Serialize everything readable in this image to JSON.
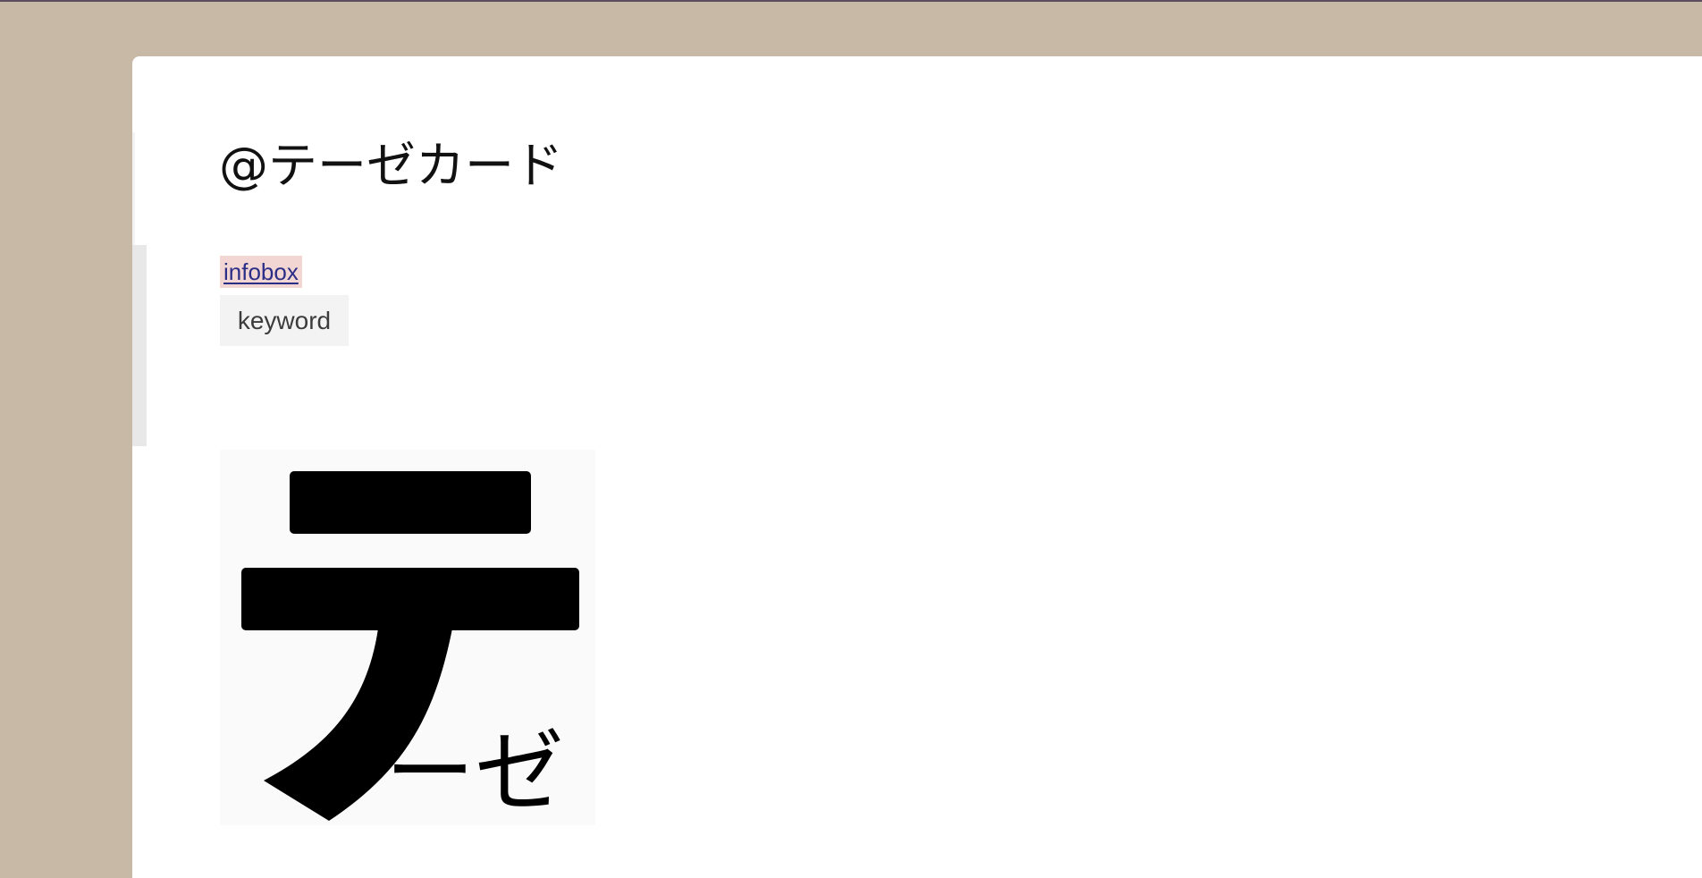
{
  "page": {
    "title": "@テーゼカード",
    "links": {
      "infobox": "infobox"
    },
    "tags": {
      "keyword": "keyword"
    },
    "image": {
      "big_glyph": "テ",
      "small_text": "ーゼ"
    }
  },
  "colors": {
    "background": "#c7b9a5",
    "link": "#2b2e86",
    "link_highlight": "#f2d6d3",
    "tag_background": "#f3f3f3"
  }
}
